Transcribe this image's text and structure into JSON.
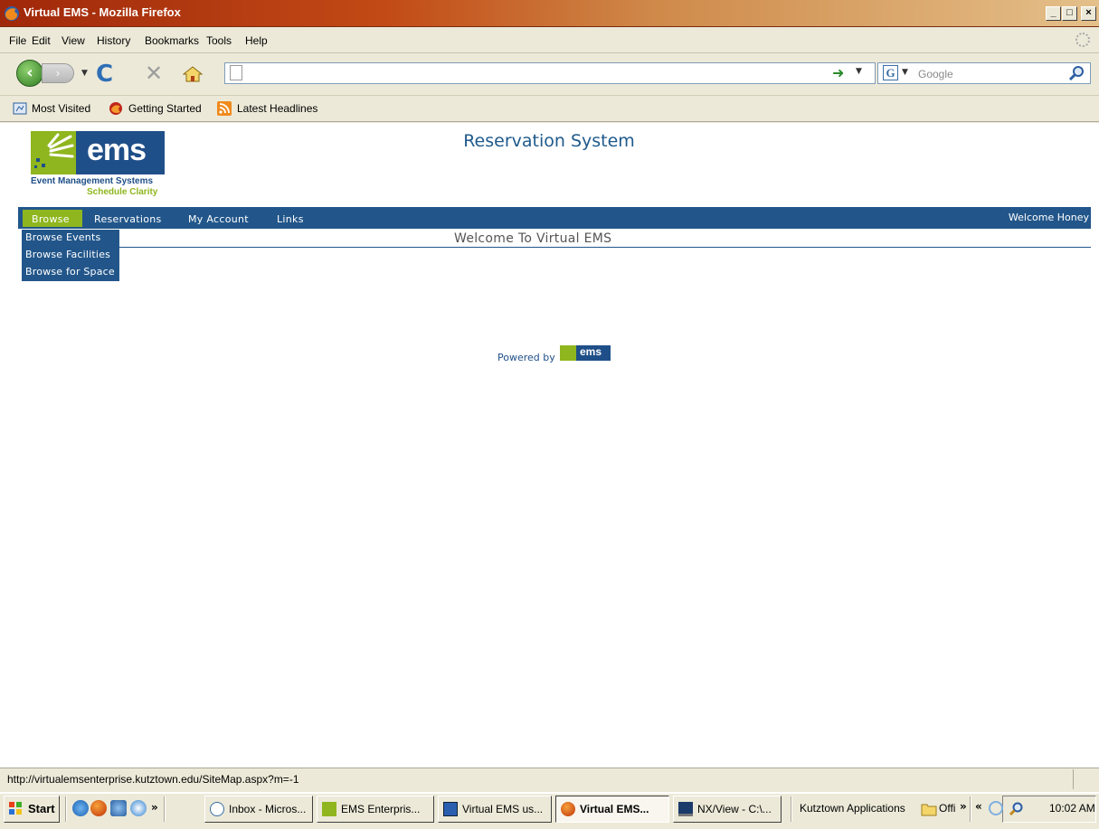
{
  "window": {
    "title": "Virtual EMS - Mozilla Firefox",
    "minimize": "_",
    "maximize": "□",
    "close": "×"
  },
  "menu": [
    "File",
    "Edit",
    "View",
    "History",
    "Bookmarks",
    "Tools",
    "Help"
  ],
  "navbar": {
    "url": "",
    "search_placeholder": "Google",
    "search_engine": "G"
  },
  "bookmarks": [
    "Most Visited",
    "Getting Started",
    "Latest Headlines"
  ],
  "page": {
    "logo_text": "ems",
    "logo_sub1": "Event Management Systems",
    "logo_sub2": "Schedule Clarity",
    "title": "Reservation System",
    "nav": [
      "Browse",
      "Reservations",
      "My Account",
      "Links"
    ],
    "welcome_user": "Welcome Honey",
    "dropdown": [
      "Browse Events",
      "Browse Facilities",
      "Browse for Space"
    ],
    "heading": "Welcome To Virtual EMS",
    "powered_by": "Powered by",
    "powered_logo": "ems"
  },
  "status": {
    "text": "http://virtualemsenterprise.kutztown.edu/SiteMap.aspx?m=-1"
  },
  "taskbar": {
    "start": "Start",
    "quicklaunch_more": "»",
    "tasks": [
      "Inbox - Micros...",
      "EMS Enterpris...",
      "Virtual EMS us...",
      "Virtual EMS...",
      "NX/View - C:\\..."
    ],
    "toolbar_label": "Kutztown Applications",
    "toolbar_item": "Offi",
    "toolbar_more": "»",
    "tray_expand": "«",
    "clock": "10:02 AM"
  },
  "colors": {
    "ems_blue": "#22568a",
    "ems_green": "#8fb61e"
  }
}
